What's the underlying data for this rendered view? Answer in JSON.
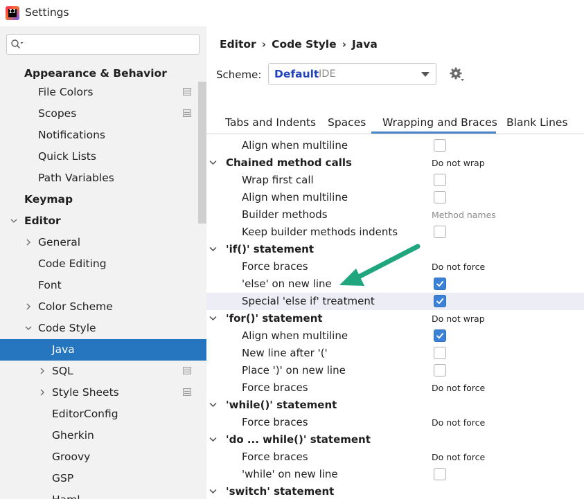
{
  "window": {
    "title": "Settings"
  },
  "sidebar": {
    "search": {
      "placeholder": "",
      "value": ""
    },
    "items": [
      {
        "label": "Appearance & Behavior",
        "bold": true
      },
      {
        "label": "File Colors"
      },
      {
        "label": "Scopes"
      },
      {
        "label": "Notifications"
      },
      {
        "label": "Quick Lists"
      },
      {
        "label": "Path Variables"
      },
      {
        "label": "Keymap",
        "bold": true
      },
      {
        "label": "Editor",
        "bold": true,
        "expanded": true
      },
      {
        "label": "General"
      },
      {
        "label": "Code Editing"
      },
      {
        "label": "Font"
      },
      {
        "label": "Color Scheme"
      },
      {
        "label": "Code Style",
        "expanded": true
      },
      {
        "label": "Java",
        "selected": true
      },
      {
        "label": "SQL"
      },
      {
        "label": "Style Sheets"
      },
      {
        "label": "EditorConfig"
      },
      {
        "label": "Gherkin"
      },
      {
        "label": "Groovy"
      },
      {
        "label": "GSP"
      },
      {
        "label": "Haml"
      }
    ]
  },
  "breadcrumb": [
    "Editor",
    "Code Style",
    "Java"
  ],
  "scheme": {
    "label": "Scheme:",
    "value": "Default",
    "tag": "IDE"
  },
  "tabs": [
    {
      "label": "Tabs and Indents"
    },
    {
      "label": "Spaces"
    },
    {
      "label": "Wrapping and Braces",
      "active": true
    },
    {
      "label": "Blank Lines"
    }
  ],
  "rows": [
    {
      "label": "Align when multiline",
      "checked": false
    },
    {
      "label": "Chained method calls",
      "value": "Do not wrap"
    },
    {
      "label": "Wrap first call",
      "checked": false
    },
    {
      "label": "Align when multiline",
      "checked": false
    },
    {
      "label": "Builder methods",
      "value": "Method names"
    },
    {
      "label": "Keep builder methods indents",
      "checked": false
    },
    {
      "label": "'if()' statement"
    },
    {
      "label": "Force braces",
      "value": "Do not force"
    },
    {
      "label": "'else' on new line",
      "checked": true
    },
    {
      "label": "Special 'else if' treatment",
      "checked": true
    },
    {
      "label": "'for()' statement",
      "value": "Do not wrap"
    },
    {
      "label": "Align when multiline",
      "checked": true
    },
    {
      "label": "New line after '('",
      "checked": false
    },
    {
      "label": "Place ')' on new line",
      "checked": false
    },
    {
      "label": "Force braces",
      "value": "Do not force"
    },
    {
      "label": "'while()' statement"
    },
    {
      "label": "Force braces",
      "value": "Do not force"
    },
    {
      "label": "'do ... while()' statement"
    },
    {
      "label": "Force braces",
      "value": "Do not force"
    },
    {
      "label": "'while' on new line",
      "checked": false
    },
    {
      "label": "'switch' statement"
    }
  ],
  "colors": {
    "accent": "#2675bf",
    "arrow": "#1fa67e",
    "checkbox": "#3b82d6",
    "scheme_value": "#2145b8"
  }
}
